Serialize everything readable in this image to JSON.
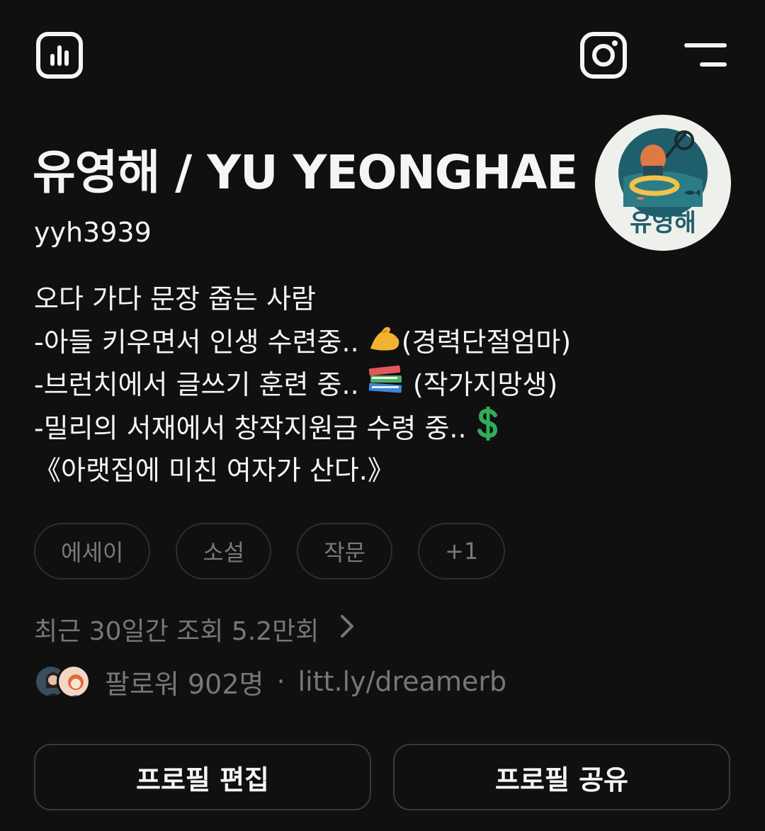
{
  "header": {
    "icons": [
      "insights-icon",
      "instagram-icon",
      "menu-icon"
    ]
  },
  "profile": {
    "display_name": "유영해 / YU YEONGHAE",
    "username": "yyh3939",
    "avatar_text": "유영해",
    "bio": {
      "line1": "오다 가다 문장 줍는 사람",
      "line2_text": "-아들 키우면서 인생 수련중.. ",
      "line2_suffix": "(경력단절엄마)",
      "line3_text": "-브런치에서 글쓰기 훈련 중.. ",
      "line3_suffix": " (작가지망생)",
      "line4_text": "-밀리의 서재에서 창작지원금 수령 중.. ",
      "line5": " 《아랫집에 미친 여자가 산다.》"
    },
    "tags": [
      "에세이",
      "소설",
      "작문",
      "+1"
    ],
    "views_text": "최근 30일간 조회 5.2만회",
    "followers_text": "팔로워 902명",
    "separator": "·",
    "link_text": "litt.ly/dreamerb"
  },
  "actions": {
    "edit_label": "프로필 편집",
    "share_label": "프로필 공유"
  },
  "colors": {
    "background": "#101010",
    "text_primary": "#f3f5f7",
    "text_secondary": "#777777",
    "border": "#3a3a3a"
  }
}
